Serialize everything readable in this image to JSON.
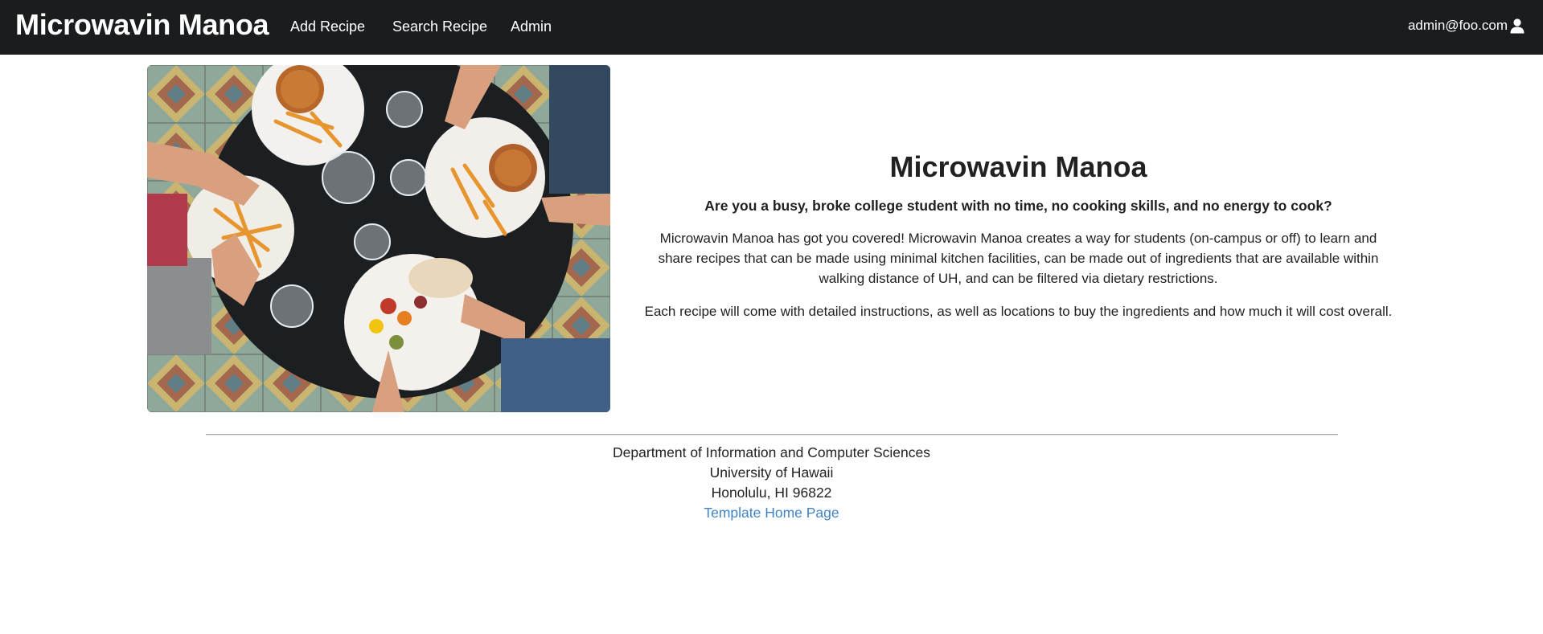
{
  "navbar": {
    "brand": "Microwavin Manoa",
    "links": [
      "Add Recipe",
      "Search Recipe",
      "Admin"
    ],
    "user_email": "admin@foo.com",
    "user_icon": "user-icon",
    "background": "#1b1c1d"
  },
  "hero": {
    "image_alt": "food-table-photo",
    "title": "Microwavin Manoa",
    "question": "Are you a busy, broke college student with no time, no cooking skills, and no energy to cook?",
    "paragraph1": "Microwavin Manoa has got you covered! Microwavin Manoa creates a way for students (on-campus or off) to learn and share recipes that can be made using minimal kitchen facilities, can be made out of ingredients that are available within walking distance of UH, and can be filtered via dietary restrictions.",
    "paragraph2": "Each recipe will come with detailed instructions, as well as locations to buy the ingredients and how much it will cost overall."
  },
  "footer": {
    "line1": "Department of Information and Computer Sciences",
    "line2": "University of Hawaii",
    "line3": "Honolulu, HI 96822",
    "link": "Template Home Page",
    "link_color": "#4183c4"
  }
}
